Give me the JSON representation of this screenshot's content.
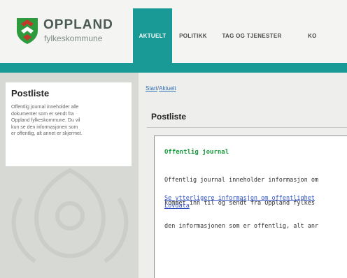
{
  "header": {
    "logo_name": "OPPLAND",
    "logo_sub": "fylkeskommune",
    "colors": {
      "accent": "#1a9a96",
      "logo_green": "#2e9a3e",
      "logo_red": "#c0392b"
    }
  },
  "nav": {
    "items": [
      {
        "label": "AKTUELT",
        "active": true
      },
      {
        "label": "POLITIKK",
        "active": false
      },
      {
        "label": "TAG OG TJENESTER",
        "active": false
      },
      {
        "label": "KO",
        "active": false
      }
    ]
  },
  "sidebar": {
    "title": "Postliste",
    "lines": [
      "Offentlig journal inneholder alle",
      "dokumenter som er sendt fra",
      "Oppland fylkeskommune. Du vil",
      "kun se den informasjonen som",
      "er offentlig, alt annet er skjermet."
    ]
  },
  "breadcrumb": {
    "start": "Start",
    "separator": "/",
    "current": "Aktuelt"
  },
  "main": {
    "title": "Postliste",
    "heading": "Offentlig journal",
    "text_lines": [
      "Offentlig journal inneholder informasjon om",
      "kommet inn til og sendt fra Oppland fylkes",
      "den informasjonen som er offentlig, alt anr"
    ],
    "link_line1": "Se ytterligere informasjon om offentlighet",
    "link_line2": "Lovdata"
  }
}
